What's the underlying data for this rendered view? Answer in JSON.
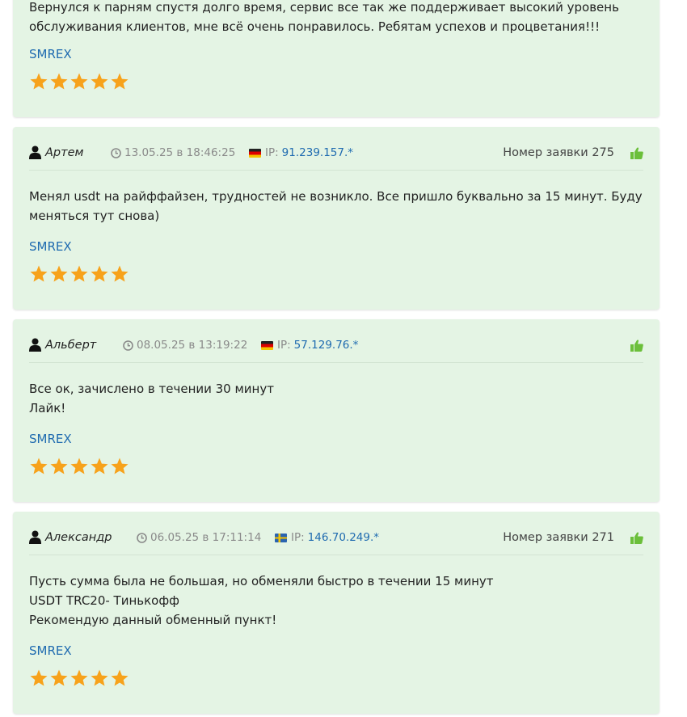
{
  "reviews": [
    {
      "body_lines": [
        "Вернулся к парням спустя долго время, сервис все так же поддерживает высокий уровень",
        "обслуживания клиентов, мне всё очень понравилось. Ребятам успехов и процветания!!!"
      ],
      "service": "SMREX",
      "rating": 5
    },
    {
      "author": "Артем",
      "date": "13.05.25 в 18:46:25",
      "ip_label": "IP:",
      "ip": "91.239.157.*",
      "flag": "de",
      "order": "Номер заявки 275",
      "body_lines": [
        "Менял usdt на райффайзен, трудностей не возникло. Все пришло буквально за 15 минут. Буду",
        "меняться тут снова)"
      ],
      "service": "SMREX",
      "rating": 5
    },
    {
      "author": "Альберт",
      "date": "08.05.25 в 13:19:22",
      "ip_label": "IP:",
      "ip": "57.129.76.*",
      "flag": "de",
      "order": "",
      "body_lines": [
        "Все ок, зачислено в течении 30 минут",
        "Лайк!"
      ],
      "service": "SMREX",
      "rating": 5
    },
    {
      "author": "Александр",
      "date": "06.05.25 в 17:11:14",
      "ip_label": "IP:",
      "ip": "146.70.249.*",
      "flag": "se",
      "order": "Номер заявки 271",
      "body_lines": [
        "Пусть сумма была не большая, но обменяли быстро в течении 15 минут",
        "USDT TRC20- Тинькофф",
        "Рекомендую данный обменный пункт!"
      ],
      "service": "SMREX",
      "rating": 5
    }
  ],
  "colors": {
    "card_bg": "#e4f4e4",
    "link": "#1f6bb0",
    "star": "#f7a21b",
    "thumb": "#6bbf3a"
  },
  "icons": {
    "user": "user-icon",
    "clock": "clock-icon",
    "thumb": "thumbs-up-icon",
    "star": "star-icon"
  }
}
